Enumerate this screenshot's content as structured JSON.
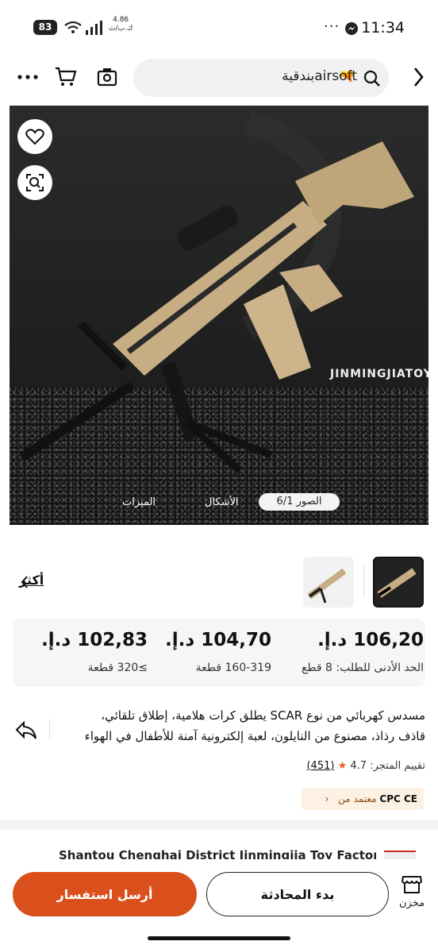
{
  "status_bar": {
    "battery": "83",
    "net_speed_value": "4.86",
    "net_speed_unit": "ك.ب/ث",
    "more_dots": "···",
    "time": "11:34"
  },
  "nav": {
    "search_text": "airsoftبندقية",
    "search_emoji": "🔫"
  },
  "hero": {
    "watermark": "JINMINGJIATOYS",
    "tabs": {
      "photos": "الصور 6/1",
      "shapes": "الأشكال",
      "features": "الميزات"
    }
  },
  "thumbs": {
    "more_label": "أكثر"
  },
  "prices": [
    {
      "value": "106,20 د.إ.",
      "qty": "الحد الأدنى للطلب: 8 قطع"
    },
    {
      "value": "104,70 د.إ.",
      "qty": "160-319 قطعة"
    },
    {
      "value": "102,83 د.إ.",
      "qty": "≥320 قطعة"
    }
  ],
  "product": {
    "description": "مسدس كهربائي من نوع SCAR يطلق كرات هلامية، إطلاق تلقائي، قاذف رذاذ، مصنوع من النايلون، لعبة إلكترونية آمنة للأطفال في الهواء",
    "rating_label": "تقييم المتجر:",
    "rating_value": "4.7",
    "rating_count": "(451)",
    "cert_label": "معتمد من",
    "cert_marks": "CPC CE"
  },
  "supplier": {
    "name": "Shantou Chenghai District Jinmingjia Toy Factory"
  },
  "bottom": {
    "store_label": "مخزن",
    "chat_label": "بدء المحادثة",
    "inquiry_label": "أرسل استفسار"
  },
  "colors": {
    "accent": "#d9501c",
    "cert_bg": "#fdf1e3",
    "star": "#f05a1a"
  }
}
